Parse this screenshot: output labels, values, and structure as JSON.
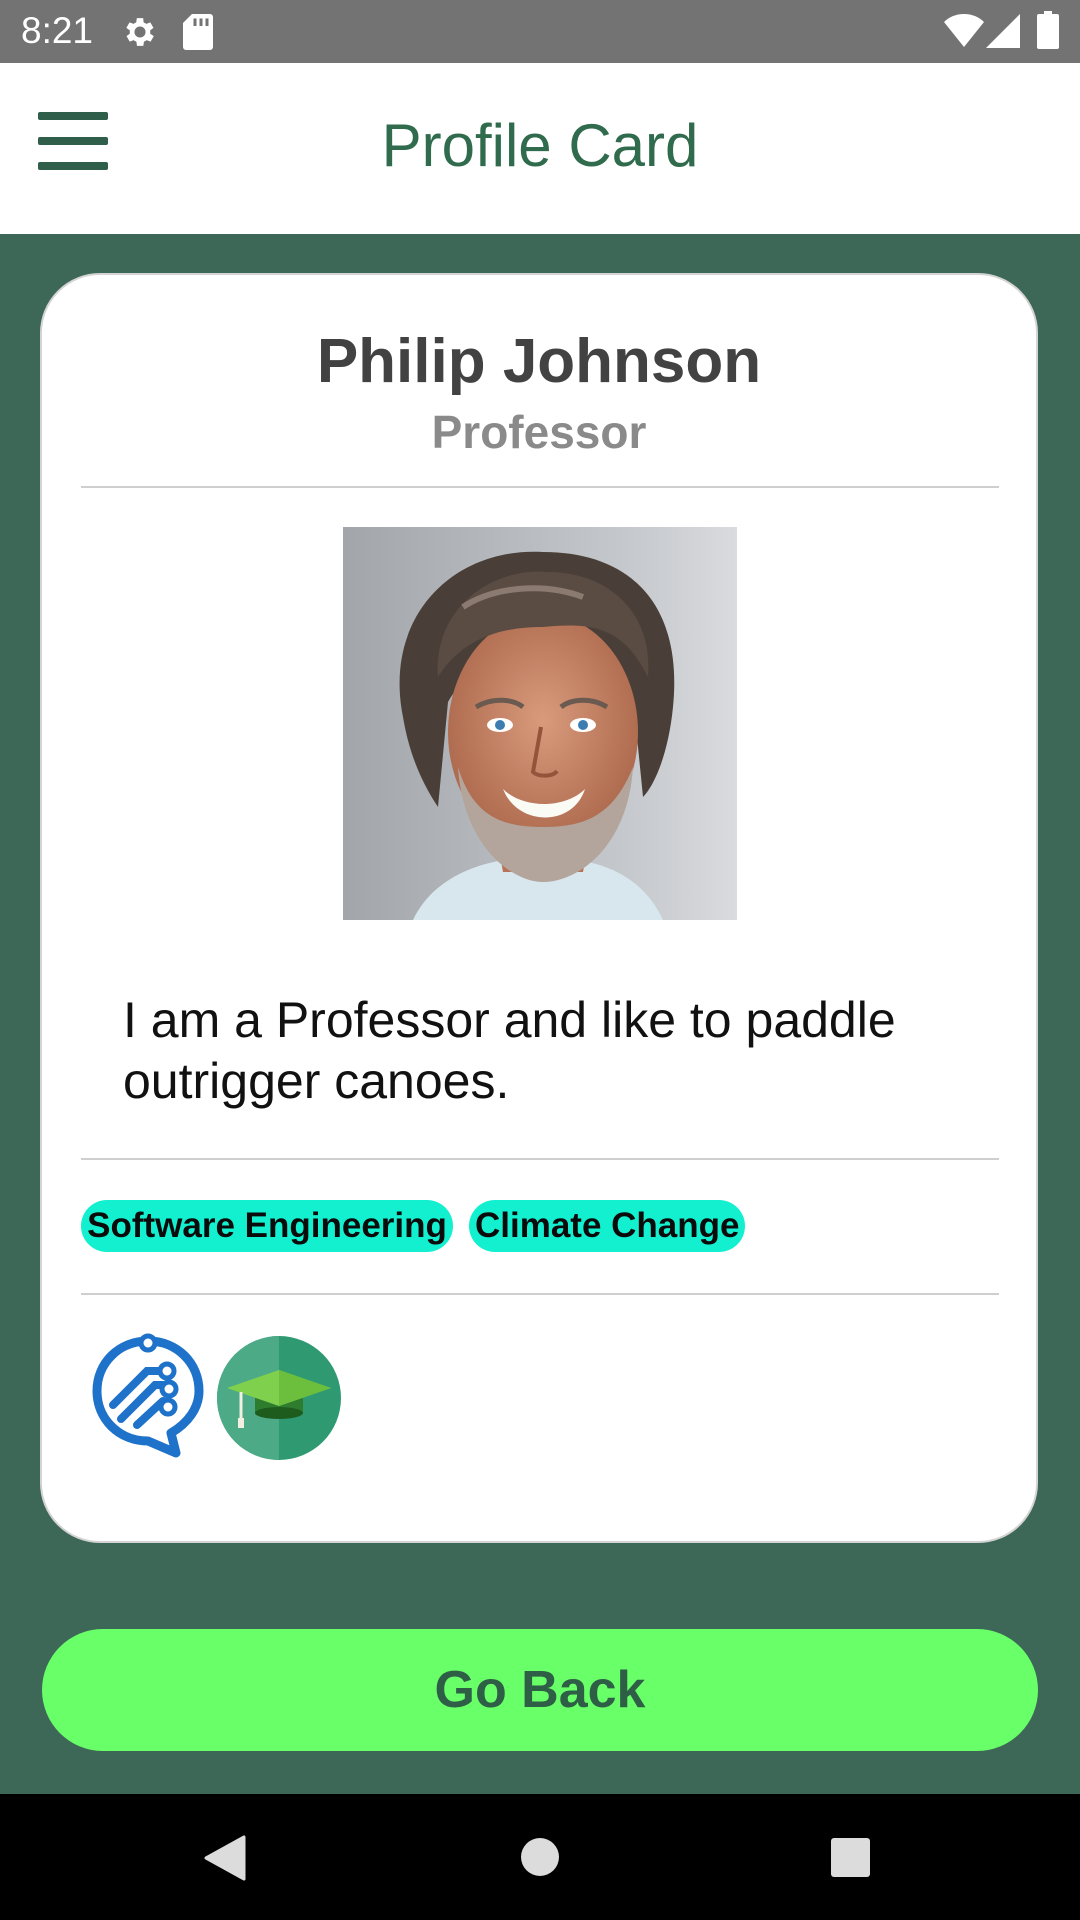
{
  "status_bar": {
    "time": "8:21",
    "icons": [
      "gear-icon",
      "sd-card-icon",
      "wifi-icon",
      "signal-icon",
      "battery-icon"
    ]
  },
  "app_bar": {
    "title": "Profile Card",
    "menu_icon": "hamburger-menu-icon"
  },
  "profile": {
    "name": "Philip Johnson",
    "title": "Professor",
    "photo": "portrait-photo",
    "bio": "I am a Professor and like to paddle outrigger canoes.",
    "tags": [
      "Software Engineering",
      "Climate Change"
    ],
    "badges": [
      "tech-chat-icon",
      "graduation-cap-icon"
    ]
  },
  "go_back_label": "Go Back",
  "nav_bar": {
    "icons": [
      "back-triangle-icon",
      "home-circle-icon",
      "recents-square-icon"
    ]
  },
  "colors": {
    "background": "#3d6756",
    "accent_text": "#2f6b4c",
    "button": "#68ff68",
    "tag": "#12f0d0"
  }
}
